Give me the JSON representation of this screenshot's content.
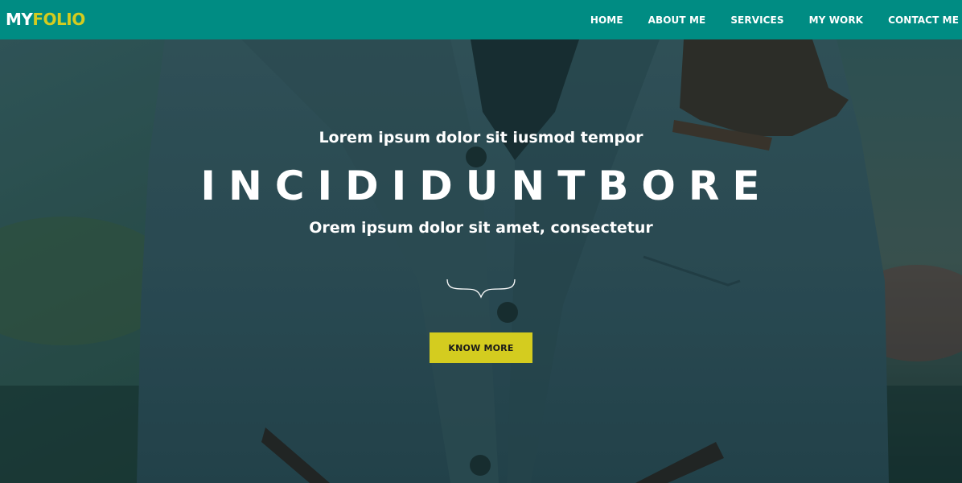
{
  "header": {
    "logo_part_1": "MY",
    "logo_part_2": "FOLIO",
    "nav": [
      {
        "label": "HOME"
      },
      {
        "label": "ABOUT ME"
      },
      {
        "label": "SERVICES"
      },
      {
        "label": "MY WORK"
      },
      {
        "label": "CONTACT ME"
      }
    ]
  },
  "hero": {
    "kicker": "Lorem ipsum dolor sit iusmod tempor",
    "title": "INCIDIDUNTBORE",
    "subtitle": "Orem ipsum dolor sit amet, consectetur",
    "divider_icon": "curly-brace-icon",
    "cta_label": "KNOW MORE"
  },
  "colors": {
    "navbar": "#008c83",
    "logo_accent": "#d4cc1f",
    "cta_background": "#d4cc1f",
    "text": "#ffffff"
  }
}
